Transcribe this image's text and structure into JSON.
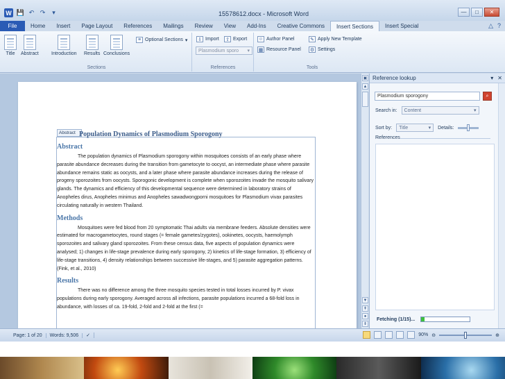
{
  "window": {
    "title": "15578612.docx - Microsoft Word",
    "controls": [
      "—",
      "□",
      "✕"
    ]
  },
  "qat": {
    "icons": [
      "save-icon",
      "undo-icon",
      "redo-icon",
      "customize-icon"
    ],
    "glyphs": [
      "💾",
      "↶",
      "↷",
      "▾"
    ],
    "app_letter": "W"
  },
  "ribbon_tabs": {
    "file": "File",
    "items": [
      "Home",
      "Insert",
      "Page Layout",
      "References",
      "Mailings",
      "Review",
      "View",
      "Add-Ins",
      "Creative Commons",
      "Insert Sections",
      "Insert Special"
    ],
    "active_index": 9,
    "help_glyphs": [
      "△",
      "?"
    ]
  },
  "ribbon": {
    "sections_group": {
      "label": "Sections",
      "buttons": [
        "Title",
        "Abstract",
        "Introduction",
        "Results",
        "Conclusions"
      ],
      "optional": "Optional Sections"
    },
    "references_group": {
      "label": "References",
      "import": "Import",
      "export": "Export",
      "search_value": "Plasmodium sporo"
    },
    "tools_group": {
      "label": "Tools",
      "author_panel": "Author Panel",
      "resource_panel": "Resource Panel",
      "apply_template": "Apply New Template",
      "settings": "Settings"
    }
  },
  "document": {
    "control_tag": "Abstract",
    "title": "Population Dynamics of Plasmodium Sporogony",
    "sections": [
      {
        "heading": "Abstract",
        "text": "The population dynamics of Plasmodium sporogony within mosquitoes consists of an early phase where parasite abundance decreases during the transition from gametocyte to oocyst, an intermediate phase where parasite abundance remains static as oocysts, and a later phase where parasite abundance increases during the release of progeny sporozoites from oocysts. Sporogonic development is complete when sporozoites invade the mosquito salivary glands. The dynamics and efficiency of this developmental sequence were determined in laboratory strains of Anopheles dirus, Anopheles minimus and Anopheles sawadwongporni mosquitoes for Plasmodium vivax parasites circulating naturally in western Thailand."
      },
      {
        "heading": "Methods",
        "text": "Mosquitoes were fed blood from 20 symptomatic Thai adults via membrane feeders. Absolute densities were estimated for macrogametocytes, round stages (= female gametes/zygotes), ookinetes, oocysts, haemolymph sporozoites and salivary gland sporozoites. From these census data, five aspects of population dynamics were analysed; 1) changes in life-stage prevalence during early sporogony, 2) kinetics of life-stage formation, 3) efficiency of life-stage transitions, 4) density relationships between successive life-stages, and 5) parasite aggregation patterns. (Fink, et al., 2010)"
      },
      {
        "heading": "Results",
        "text": "There was no difference among the three mosquito species tested in total losses incurred by P. vivax populations during early sporogony. Averaged across all infections, parasite populations incurred a 68-fold loss in abundance, with losses of ca. 19-fold, 2-fold and 2-fold at the first (="
      }
    ]
  },
  "pane": {
    "title": "Reference lookup",
    "search_value": "Plasmodium sporogony",
    "search_in_label": "Search in:",
    "search_in_value": "Content",
    "sort_label": "Sort by:",
    "sort_value": "Title",
    "details_label": "Details:",
    "details_level": 0.5,
    "references_label": "References",
    "fetching_text": "Fetching (1/15)...",
    "progress": 0.07
  },
  "status": {
    "page": "Page: 1 of 20",
    "words": "Words: 9,506",
    "zoom": "90%"
  },
  "colors": {
    "accent": "#2a5bb5",
    "heading": "#4a76a8",
    "progress": "#3fbf3f"
  }
}
